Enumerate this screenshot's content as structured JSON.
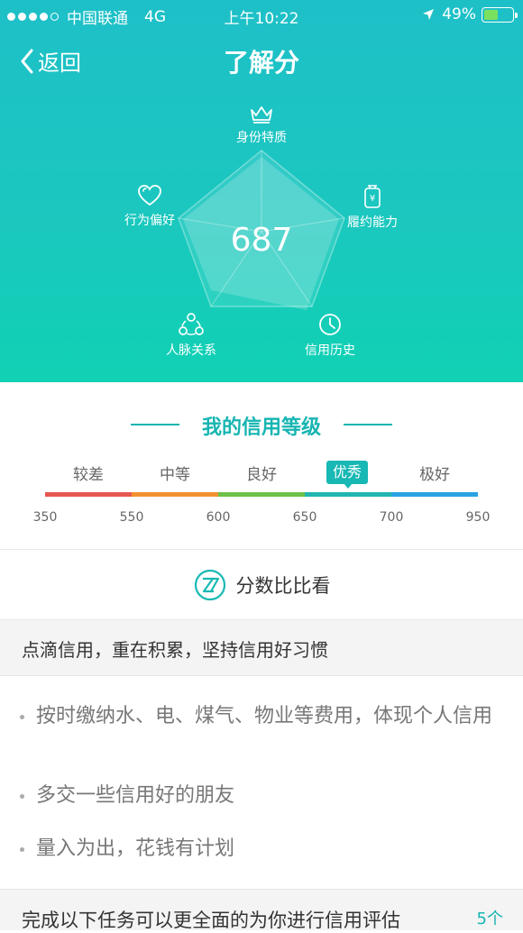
{
  "status_bar": {
    "carrier": "中国联通",
    "network": "4G",
    "time": "上午10:22",
    "battery": "49%",
    "battery_level": 0.49
  },
  "nav": {
    "back_label": "返回",
    "title": "了解分"
  },
  "radar": {
    "score": "687",
    "dimensions": {
      "identity": "身份特质",
      "ability": "履约能力",
      "history": "信用历史",
      "connections": "人脉关系",
      "behavior": "行为偏好"
    },
    "icons": {
      "identity": "crown-icon",
      "ability": "wallet-icon",
      "history": "clock-icon",
      "connections": "network-icon",
      "behavior": "heart-icon"
    }
  },
  "level": {
    "title": "我的信用等级",
    "grades": [
      "较差",
      "中等",
      "良好",
      "优秀",
      "极好"
    ],
    "current": "优秀",
    "ticks": [
      "350",
      "550",
      "600",
      "650",
      "700",
      "950"
    ],
    "colors": [
      "#e7574f",
      "#f2922f",
      "#6cc24a",
      "#21b6b0",
      "#28a3e3"
    ]
  },
  "compare": {
    "label": "分数比比看",
    "icon": "zhima-logo-icon"
  },
  "tips": {
    "header": "点滴信用，重在积累，坚持信用好习惯",
    "items": [
      "按时缴纳水、电、煤气、物业等费用，体现个人信用",
      "多交一些信用好的朋友",
      "量入为出，花钱有计划"
    ]
  },
  "tasks": {
    "text": "完成以下任务可以更全面的为你进行信用评估",
    "count": "5个"
  }
}
